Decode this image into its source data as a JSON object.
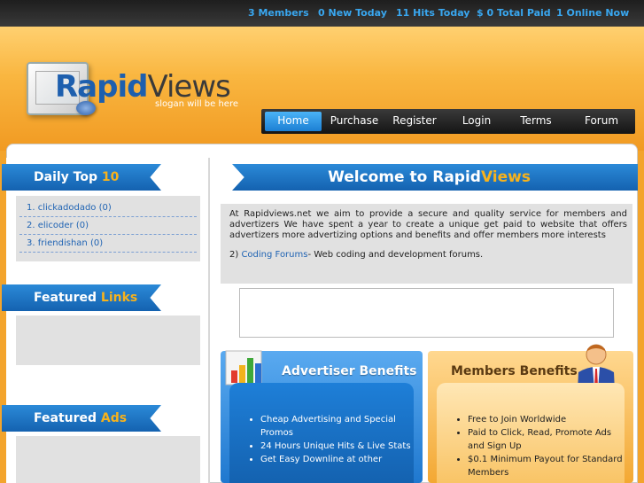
{
  "stats": {
    "members": "3 Members",
    "new_today": "0 New Today",
    "hits_today": "11 Hits Today",
    "total_paid": "$ 0 Total Paid",
    "online_now": "1 Online Now"
  },
  "logo": {
    "rapid": "Rapid",
    "views": "Views",
    "slogan": "slogan will be here"
  },
  "nav": {
    "items": [
      "Home",
      "Purchase",
      "Register",
      "Login",
      "Terms",
      "Forum"
    ],
    "active": "Home"
  },
  "sidebar": {
    "daily_top": {
      "title": "Daily Top ",
      "highlight": "10"
    },
    "top_list": [
      "1. clickadodado (0)",
      "2. elicoder (0)",
      "3. friendishan (0)"
    ],
    "featured_links": {
      "title": "Featured ",
      "highlight": "Links"
    },
    "featured_ads": {
      "title": "Featured ",
      "highlight": "Ads"
    }
  },
  "main": {
    "welcome": {
      "title": "Welcome to Rapid",
      "highlight": "Views"
    },
    "intro_text": "At Rapidviews.net we aim to provide a secure and quality service for members and advertizers We have spent a year to create a unique get paid to website that offers advertizers more advertizing options and benefits and offer members more interests",
    "forum_prefix": "2) ",
    "forum_link": "Coding Forums",
    "forum_suffix": "- Web coding and development forums.",
    "advertiser": {
      "title": "Advertiser Benefits",
      "items": [
        "Cheap Advertising and Special Promos",
        "24 Hours Unique Hits & Live Stats",
        "Get Easy Downline at other"
      ]
    },
    "members": {
      "title": "Members Benefits",
      "items": [
        "Free to Join Worldwide",
        "Paid to Click, Read, Promote Ads and Sign Up",
        "$0.1 Minimum Payout for Standard Members"
      ]
    }
  },
  "colors": {
    "accent_blue": "#1f78cf",
    "accent_orange": "#f3a42c",
    "highlight_yellow": "#f7b21c"
  }
}
